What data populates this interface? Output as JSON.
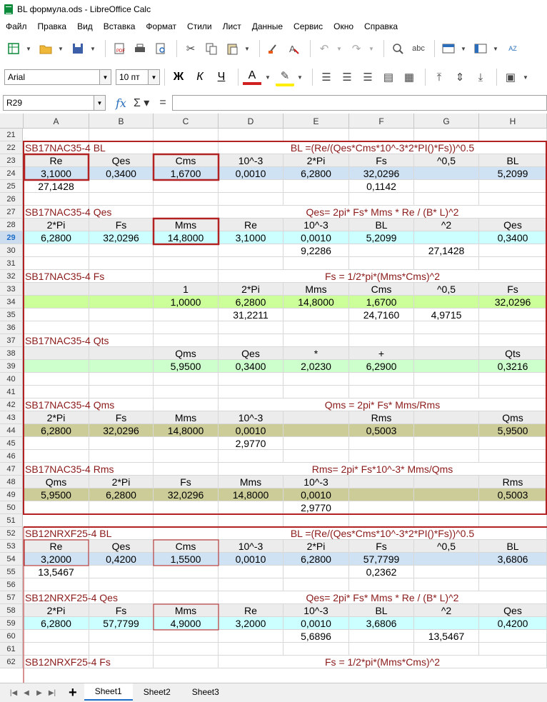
{
  "window": {
    "title": "BL формула.ods - LibreOffice Calc"
  },
  "menu": [
    "Файл",
    "Правка",
    "Вид",
    "Вставка",
    "Формат",
    "Стили",
    "Лист",
    "Данные",
    "Сервис",
    "Окно",
    "Справка"
  ],
  "font": {
    "name": "Arial",
    "size": "10 пт"
  },
  "format_buttons": {
    "bold": "Ж",
    "italic": "К",
    "underline": "Ч",
    "font_color": "A"
  },
  "formula_bar": {
    "cell_ref": "R29",
    "value": ""
  },
  "columns": [
    "A",
    "B",
    "C",
    "D",
    "E",
    "F",
    "G",
    "H"
  ],
  "colors": {
    "title": "#8b1a1a",
    "blue": "#cfe2f3",
    "cyan": "#ccffff",
    "green": "#ccff99",
    "lightgreen": "#ccffcc",
    "olive": "#cccc99",
    "header": "#ececec",
    "box": "#b22222"
  },
  "active_row": "29",
  "rows": [
    {
      "n": "21",
      "cells": []
    },
    {
      "n": "22",
      "cells": [
        {
          "c": 0,
          "t": "SB17NAC35-4 BL",
          "k": "title"
        },
        {
          "c": 3,
          "span": 5,
          "t": "BL =(Re/(Qes*Cms*10^-3*2*PI()*Fs))^0.5",
          "k": "title",
          "align": "c"
        }
      ]
    },
    {
      "n": "23",
      "fill": "header",
      "cells": [
        {
          "c": 0,
          "t": "Re"
        },
        {
          "c": 1,
          "t": "Qes"
        },
        {
          "c": 2,
          "t": "Cms"
        },
        {
          "c": 3,
          "t": "10^-3"
        },
        {
          "c": 4,
          "t": "2*Pi"
        },
        {
          "c": 5,
          "t": "Fs"
        },
        {
          "c": 6,
          "t": "^0,5"
        },
        {
          "c": 7,
          "t": "BL"
        }
      ]
    },
    {
      "n": "24",
      "fill": "blue",
      "cells": [
        {
          "c": 0,
          "t": "3,1000"
        },
        {
          "c": 1,
          "t": "0,3400"
        },
        {
          "c": 2,
          "t": "1,6700"
        },
        {
          "c": 3,
          "t": "0,0010"
        },
        {
          "c": 4,
          "t": "6,2800"
        },
        {
          "c": 5,
          "t": "32,0296"
        },
        {
          "c": 6,
          "t": ""
        },
        {
          "c": 7,
          "t": "5,2099"
        }
      ]
    },
    {
      "n": "25",
      "cells": [
        {
          "c": 0,
          "t": "27,1428"
        },
        {
          "c": 5,
          "t": "0,1142"
        }
      ]
    },
    {
      "n": "26",
      "cells": []
    },
    {
      "n": "27",
      "cells": [
        {
          "c": 0,
          "t": "SB17NAC35-4 Qes",
          "k": "title"
        },
        {
          "c": 3,
          "span": 5,
          "t": "Qes= 2pi* Fs* Mms * Re / (B* L)^2",
          "k": "title",
          "align": "c"
        }
      ]
    },
    {
      "n": "28",
      "fill": "header",
      "cells": [
        {
          "c": 0,
          "t": "2*Pi"
        },
        {
          "c": 1,
          "t": "Fs"
        },
        {
          "c": 2,
          "t": "Mms"
        },
        {
          "c": 3,
          "t": "Re"
        },
        {
          "c": 4,
          "t": "10^-3"
        },
        {
          "c": 5,
          "t": "BL"
        },
        {
          "c": 6,
          "t": "^2"
        },
        {
          "c": 7,
          "t": "Qes"
        }
      ]
    },
    {
      "n": "29",
      "fill": "cyan",
      "cells": [
        {
          "c": 0,
          "t": "6,2800"
        },
        {
          "c": 1,
          "t": "32,0296"
        },
        {
          "c": 2,
          "t": "14,8000"
        },
        {
          "c": 3,
          "t": "3,1000"
        },
        {
          "c": 4,
          "t": "0,0010"
        },
        {
          "c": 5,
          "t": "5,2099"
        },
        {
          "c": 7,
          "t": "0,3400"
        }
      ]
    },
    {
      "n": "30",
      "cells": [
        {
          "c": 4,
          "t": "9,2286"
        },
        {
          "c": 6,
          "t": "27,1428"
        }
      ]
    },
    {
      "n": "31",
      "cells": []
    },
    {
      "n": "32",
      "cells": [
        {
          "c": 0,
          "t": "SB17NAC35-4 Fs",
          "k": "title"
        },
        {
          "c": 3,
          "span": 5,
          "t": "Fs = 1/2*pi*(Mms*Cms)^2",
          "k": "title",
          "align": "c"
        }
      ]
    },
    {
      "n": "33",
      "fill": "header",
      "cells": [
        {
          "c": 2,
          "t": "1"
        },
        {
          "c": 3,
          "t": "2*Pi"
        },
        {
          "c": 4,
          "t": "Mms"
        },
        {
          "c": 5,
          "t": "Cms"
        },
        {
          "c": 6,
          "t": "^0,5"
        },
        {
          "c": 7,
          "t": "Fs"
        }
      ]
    },
    {
      "n": "34",
      "fill": "green",
      "cells": [
        {
          "c": 2,
          "t": "1,0000"
        },
        {
          "c": 3,
          "t": "6,2800"
        },
        {
          "c": 4,
          "t": "14,8000"
        },
        {
          "c": 5,
          "t": "1,6700"
        },
        {
          "c": 7,
          "t": "32,0296"
        }
      ]
    },
    {
      "n": "35",
      "cells": [
        {
          "c": 3,
          "t": "31,2211"
        },
        {
          "c": 5,
          "t": "24,7160"
        },
        {
          "c": 6,
          "t": "4,9715"
        }
      ]
    },
    {
      "n": "36",
      "cells": []
    },
    {
      "n": "37",
      "cells": [
        {
          "c": 0,
          "t": "SB17NAC35-4 Qts",
          "k": "title"
        }
      ]
    },
    {
      "n": "38",
      "fill": "header",
      "cells": [
        {
          "c": 2,
          "t": "Qms"
        },
        {
          "c": 3,
          "t": "Qes"
        },
        {
          "c": 4,
          "t": "*"
        },
        {
          "c": 5,
          "t": "+"
        },
        {
          "c": 7,
          "t": "Qts"
        }
      ]
    },
    {
      "n": "39",
      "fill": "lightgreen",
      "cells": [
        {
          "c": 2,
          "t": "5,9500"
        },
        {
          "c": 3,
          "t": "0,3400"
        },
        {
          "c": 4,
          "t": "2,0230"
        },
        {
          "c": 5,
          "t": "6,2900"
        },
        {
          "c": 7,
          "t": "0,3216"
        }
      ]
    },
    {
      "n": "40",
      "cells": []
    },
    {
      "n": "41",
      "cells": []
    },
    {
      "n": "42",
      "cells": [
        {
          "c": 0,
          "t": "SB17NAC35-4 Qms",
          "k": "title"
        },
        {
          "c": 3,
          "span": 5,
          "t": "Qms = 2pi* Fs* Mms/Rms",
          "k": "title",
          "align": "c"
        }
      ]
    },
    {
      "n": "43",
      "fill": "header",
      "cells": [
        {
          "c": 0,
          "t": "2*Pi"
        },
        {
          "c": 1,
          "t": "Fs"
        },
        {
          "c": 2,
          "t": "Mms"
        },
        {
          "c": 3,
          "t": "10^-3"
        },
        {
          "c": 5,
          "t": "Rms"
        },
        {
          "c": 7,
          "t": "Qms"
        }
      ]
    },
    {
      "n": "44",
      "fill": "olive",
      "cells": [
        {
          "c": 0,
          "t": "6,2800"
        },
        {
          "c": 1,
          "t": "32,0296"
        },
        {
          "c": 2,
          "t": "14,8000"
        },
        {
          "c": 3,
          "t": "0,0010"
        },
        {
          "c": 5,
          "t": "0,5003"
        },
        {
          "c": 7,
          "t": "5,9500"
        }
      ]
    },
    {
      "n": "45",
      "cells": [
        {
          "c": 3,
          "t": "2,9770"
        }
      ]
    },
    {
      "n": "46",
      "cells": []
    },
    {
      "n": "47",
      "cells": [
        {
          "c": 0,
          "t": "SB17NAC35-4 Rms",
          "k": "title"
        },
        {
          "c": 3,
          "span": 5,
          "t": "Rms= 2pi* Fs*10^-3* Mms/Qms",
          "k": "title",
          "align": "c"
        }
      ]
    },
    {
      "n": "48",
      "fill": "header",
      "cells": [
        {
          "c": 0,
          "t": "Qms"
        },
        {
          "c": 1,
          "t": "2*Pi"
        },
        {
          "c": 2,
          "t": "Fs"
        },
        {
          "c": 3,
          "t": "Mms"
        },
        {
          "c": 4,
          "t": "10^-3"
        },
        {
          "c": 7,
          "t": "Rms"
        }
      ]
    },
    {
      "n": "49",
      "fill": "olive",
      "cells": [
        {
          "c": 0,
          "t": "5,9500"
        },
        {
          "c": 1,
          "t": "6,2800"
        },
        {
          "c": 2,
          "t": "32,0296"
        },
        {
          "c": 3,
          "t": "14,8000"
        },
        {
          "c": 4,
          "t": "0,0010"
        },
        {
          "c": 7,
          "t": "0,5003"
        }
      ]
    },
    {
      "n": "50",
      "cells": [
        {
          "c": 4,
          "t": "2,9770"
        }
      ]
    },
    {
      "n": "51",
      "cells": []
    },
    {
      "n": "52",
      "cells": [
        {
          "c": 0,
          "t": "SB12NRXF25-4 BL",
          "k": "title"
        },
        {
          "c": 3,
          "span": 5,
          "t": "BL =(Re/(Qes*Cms*10^-3*2*PI()*Fs))^0.5",
          "k": "title",
          "align": "c"
        }
      ]
    },
    {
      "n": "53",
      "fill": "header",
      "cells": [
        {
          "c": 0,
          "t": "Re"
        },
        {
          "c": 1,
          "t": "Qes"
        },
        {
          "c": 2,
          "t": "Cms"
        },
        {
          "c": 3,
          "t": "10^-3"
        },
        {
          "c": 4,
          "t": "2*Pi"
        },
        {
          "c": 5,
          "t": "Fs"
        },
        {
          "c": 6,
          "t": "^0,5"
        },
        {
          "c": 7,
          "t": "BL"
        }
      ]
    },
    {
      "n": "54",
      "fill": "blue",
      "cells": [
        {
          "c": 0,
          "t": "3,2000"
        },
        {
          "c": 1,
          "t": "0,4200"
        },
        {
          "c": 2,
          "t": "1,5500"
        },
        {
          "c": 3,
          "t": "0,0010"
        },
        {
          "c": 4,
          "t": "6,2800"
        },
        {
          "c": 5,
          "t": "57,7799"
        },
        {
          "c": 7,
          "t": "3,6806"
        }
      ]
    },
    {
      "n": "55",
      "cells": [
        {
          "c": 0,
          "t": "13,5467"
        },
        {
          "c": 5,
          "t": "0,2362"
        }
      ]
    },
    {
      "n": "56",
      "cells": []
    },
    {
      "n": "57",
      "cells": [
        {
          "c": 0,
          "t": "SB12NRXF25-4 Qes",
          "k": "title"
        },
        {
          "c": 3,
          "span": 5,
          "t": "Qes= 2pi* Fs* Mms * Re / (B* L)^2",
          "k": "title",
          "align": "c"
        }
      ]
    },
    {
      "n": "58",
      "fill": "header",
      "cells": [
        {
          "c": 0,
          "t": "2*Pi"
        },
        {
          "c": 1,
          "t": "Fs"
        },
        {
          "c": 2,
          "t": "Mms"
        },
        {
          "c": 3,
          "t": "Re"
        },
        {
          "c": 4,
          "t": "10^-3"
        },
        {
          "c": 5,
          "t": "BL"
        },
        {
          "c": 6,
          "t": "^2"
        },
        {
          "c": 7,
          "t": "Qes"
        }
      ]
    },
    {
      "n": "59",
      "fill": "cyan",
      "cells": [
        {
          "c": 0,
          "t": "6,2800"
        },
        {
          "c": 1,
          "t": "57,7799"
        },
        {
          "c": 2,
          "t": "4,9000"
        },
        {
          "c": 3,
          "t": "3,2000"
        },
        {
          "c": 4,
          "t": "0,0010"
        },
        {
          "c": 5,
          "t": "3,6806"
        },
        {
          "c": 7,
          "t": "0,4200"
        }
      ]
    },
    {
      "n": "60",
      "cells": [
        {
          "c": 4,
          "t": "5,6896"
        },
        {
          "c": 6,
          "t": "13,5467"
        }
      ]
    },
    {
      "n": "61",
      "cells": []
    },
    {
      "n": "62",
      "cells": [
        {
          "c": 0,
          "t": "SB12NRXF25-4 Fs",
          "k": "title"
        },
        {
          "c": 3,
          "span": 5,
          "t": "Fs = 1/2*pi*(Mms*Cms)^2",
          "k": "title",
          "align": "c"
        }
      ]
    }
  ],
  "sheets": [
    "Sheet1",
    "Sheet2",
    "Sheet3"
  ],
  "active_sheet": "Sheet1"
}
